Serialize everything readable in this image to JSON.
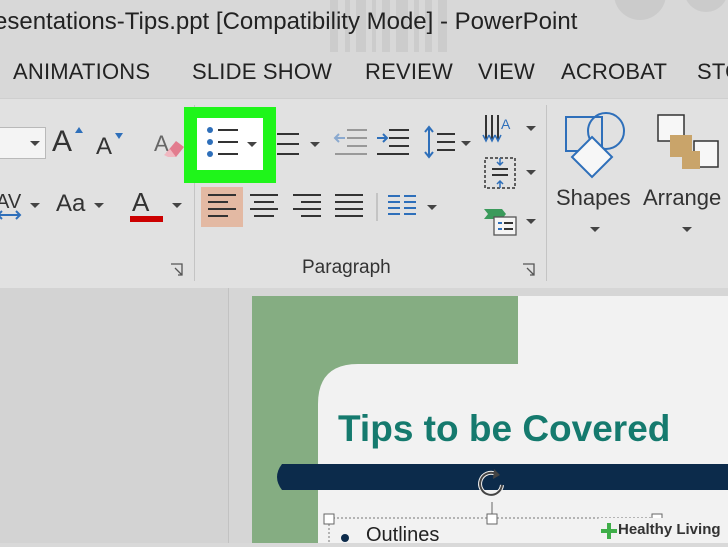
{
  "window": {
    "title": "esentations-Tips.ppt [Compatibility Mode] - PowerPoint"
  },
  "tabs": [
    {
      "label": "ANIMATIONS"
    },
    {
      "label": "SLIDE SHOW"
    },
    {
      "label": "REVIEW"
    },
    {
      "label": "VIEW"
    },
    {
      "label": "ACROBAT"
    },
    {
      "label": "STO"
    }
  ],
  "ribbon": {
    "font": {
      "size_value": "",
      "grow_label": "A",
      "shrink_label": "A",
      "spacing_label": "AV",
      "case_label": "Aa",
      "color_label": "A"
    },
    "paragraph": {
      "group_label": "Paragraph"
    },
    "drawing": {
      "shapes_label": "Shapes",
      "arrange_label": "Arrange"
    }
  },
  "slide": {
    "title": "Tips to be Covered",
    "bullets": [
      "Outlines"
    ]
  },
  "watermark": {
    "text": "Healthy Living"
  },
  "colors": {
    "highlight": "#1ff51a",
    "slide_title": "#157a6e",
    "title_bar": "#0c2b4b",
    "slide_accent": "#85ad82",
    "align_active": "#e3b9a3",
    "font_color_bar": "#cc0000"
  }
}
